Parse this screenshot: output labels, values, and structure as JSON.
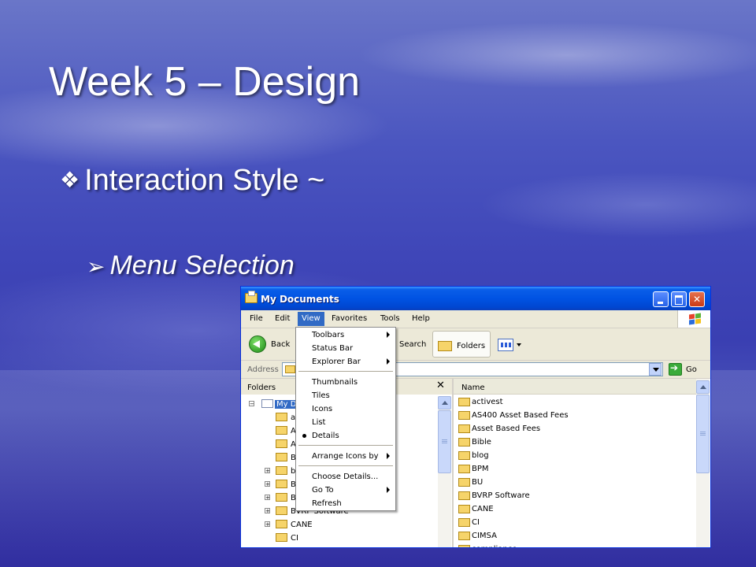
{
  "slide": {
    "title": "Week 5 – Design",
    "bullet1": "Interaction Style ~",
    "bullet2": "Menu Selection"
  },
  "window": {
    "title": "My Documents",
    "menu": [
      "File",
      "Edit",
      "View",
      "Favorites",
      "Tools",
      "Help"
    ],
    "toolbar": {
      "back": "Back",
      "search": "Search",
      "folders": "Folders"
    },
    "address": {
      "label": "Address",
      "go": "Go"
    },
    "folders_pane": {
      "header": "Folders",
      "close": "✕"
    },
    "tree": {
      "root": "My Do",
      "items": [
        "a",
        "A",
        "A",
        "B",
        "b",
        "B",
        "B",
        "BVRP Software",
        "CANE",
        "CI"
      ]
    },
    "list": {
      "column": "Name",
      "items": [
        "activest",
        "AS400 Asset Based Fees",
        "Asset Based Fees",
        "Bible",
        "blog",
        "BPM",
        "BU",
        "BVRP Software",
        "CANE",
        "CI",
        "CIMSA",
        "compliance"
      ]
    }
  },
  "view_menu": {
    "groups": [
      [
        "Toolbars",
        "Status Bar",
        "Explorer Bar"
      ],
      [
        "Thumbnails",
        "Tiles",
        "Icons",
        "List",
        "Details"
      ],
      [
        "Arrange Icons by"
      ],
      [
        "Choose Details...",
        "Go To",
        "Refresh"
      ]
    ],
    "submenu_items": [
      "Toolbars",
      "Explorer Bar",
      "Arrange Icons by",
      "Go To"
    ],
    "selected": "Details"
  },
  "colors": {
    "titlebar": "#0053e3",
    "menu_highlight": "#316ac5",
    "folder": "#f6d46a"
  }
}
